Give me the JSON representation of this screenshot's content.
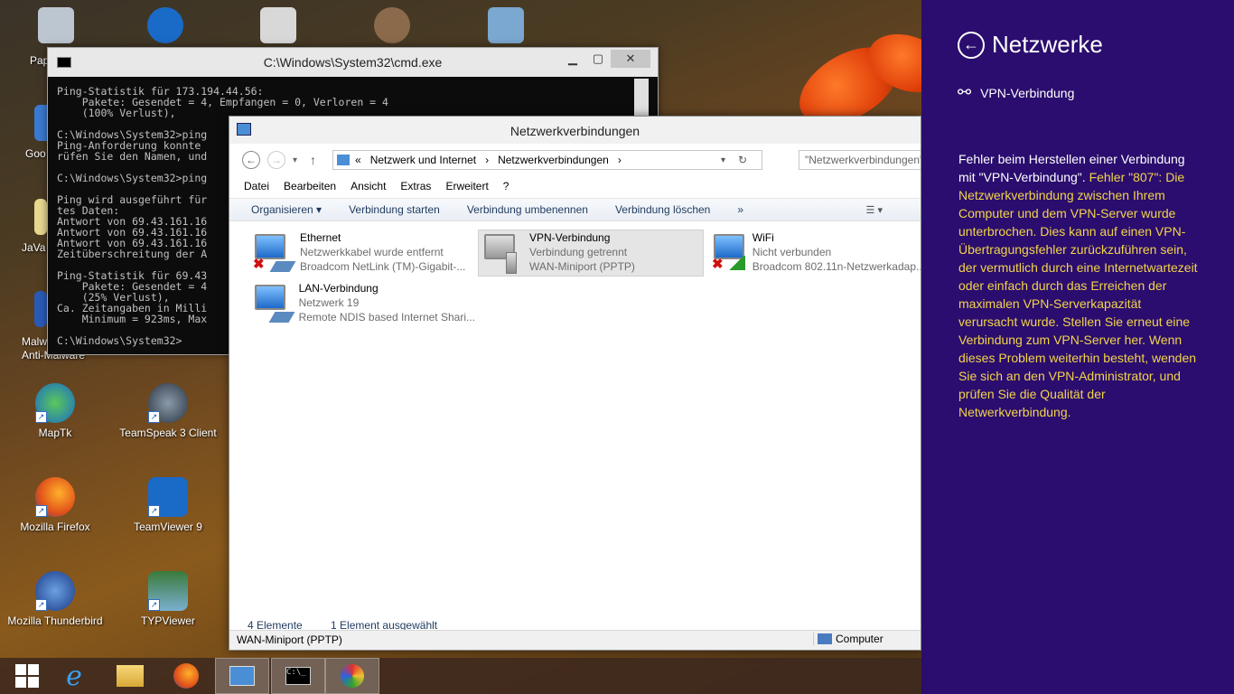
{
  "desktop": {
    "icons": [
      {
        "label": "MapTk",
        "color": "#2a8a3a"
      },
      {
        "label": "TeamSpeak 3 Client",
        "color": "#333a44"
      },
      {
        "label": "Mozilla Firefox",
        "color": "#e06a1a"
      },
      {
        "label": "TeamViewer 9",
        "color": "#1a6ac8"
      },
      {
        "label": "Mozilla Thunderbird",
        "color": "#2a5aa8"
      },
      {
        "label": "TYPViewer",
        "color": "#3a7a3a"
      }
    ],
    "partial_labels": {
      "pap": "Pap",
      "goo": "Goo",
      "java": "JaVa",
      "malw": "Malw",
      "anti": "Anti-Malware"
    }
  },
  "cmd": {
    "title": "C:\\Windows\\System32\\cmd.exe",
    "output": "Ping-Statistik für 173.194.44.56:\n    Pakete: Gesendet = 4, Empfangen = 0, Verloren = 4\n    (100% Verlust),\n\nC:\\Windows\\System32>ping\nPing-Anforderung konnte\nrüfen Sie den Namen, und\n\nC:\\Windows\\System32>ping\n\nPing wird ausgeführt für\ntes Daten:\nAntwort von 69.43.161.16\nAntwort von 69.43.161.16\nAntwort von 69.43.161.16\nZeitüberschreitung der A\n\nPing-Statistik für 69.43\n    Pakete: Gesendet = 4\n    (25% Verlust),\nCa. Zeitangaben in Milli\n    Minimum = 923ms, Max\n\nC:\\Windows\\System32>"
  },
  "netconn": {
    "title": "Netzwerkverbindungen",
    "breadcrumb": {
      "prefix": "«",
      "part1": "Netzwerk und Internet",
      "arrow": "›",
      "part2": "Netzwerkverbindungen",
      "arrow2": "›"
    },
    "search_placeholder": "\"Netzwerkverbindungen\" durchsuchen",
    "menu": [
      "Datei",
      "Bearbeiten",
      "Ansicht",
      "Extras",
      "Erweitert",
      "?"
    ],
    "toolbar": [
      "Organisieren ▾",
      "Verbindung starten",
      "Verbindung umbenennen",
      "Verbindung löschen",
      "»"
    ],
    "connections": [
      {
        "name": "Ethernet",
        "status": "Netzwerkkabel wurde entfernt",
        "device": "Broadcom NetLink (TM)-Gigabit-..."
      },
      {
        "name": "VPN-Verbindung",
        "status": "Verbindung getrennt",
        "device": "WAN-Miniport (PPTP)"
      },
      {
        "name": "WiFi",
        "status": "Nicht verbunden",
        "device": "Broadcom 802.11n-Netzwerkadap..."
      },
      {
        "name": "LAN-Verbindung",
        "status": "Netzwerk  19",
        "device": "Remote NDIS based Internet Shari..."
      }
    ],
    "status_count": "4 Elemente",
    "status_selected": "1 Element ausgewählt",
    "details_left": "WAN-Miniport (PPTP)",
    "details_right": "Computer"
  },
  "charm": {
    "title": "Netzwerke",
    "vpn_label": "VPN-Verbindung",
    "error_white": "Fehler beim Herstellen einer Verbindung mit \"VPN-Verbindung\".",
    "error_yellow": "Fehler \"807\": Die Netzwerkverbindung zwischen Ihrem Computer und dem VPN-Server wurde unterbrochen. Dies kann auf einen VPN-Übertragungsfehler zurückzuführen sein, der vermutlich durch eine Internetwartezeit oder einfach durch das Erreichen der maximalen VPN-Serverkapazität verursacht wurde. Stellen Sie erneut eine Verbindung zum VPN-Server her. Wenn dieses Problem weiterhin besteht, wenden Sie sich an den VPN-Administrator, und prüfen Sie die Qualität der Netwerkverbindung."
  }
}
